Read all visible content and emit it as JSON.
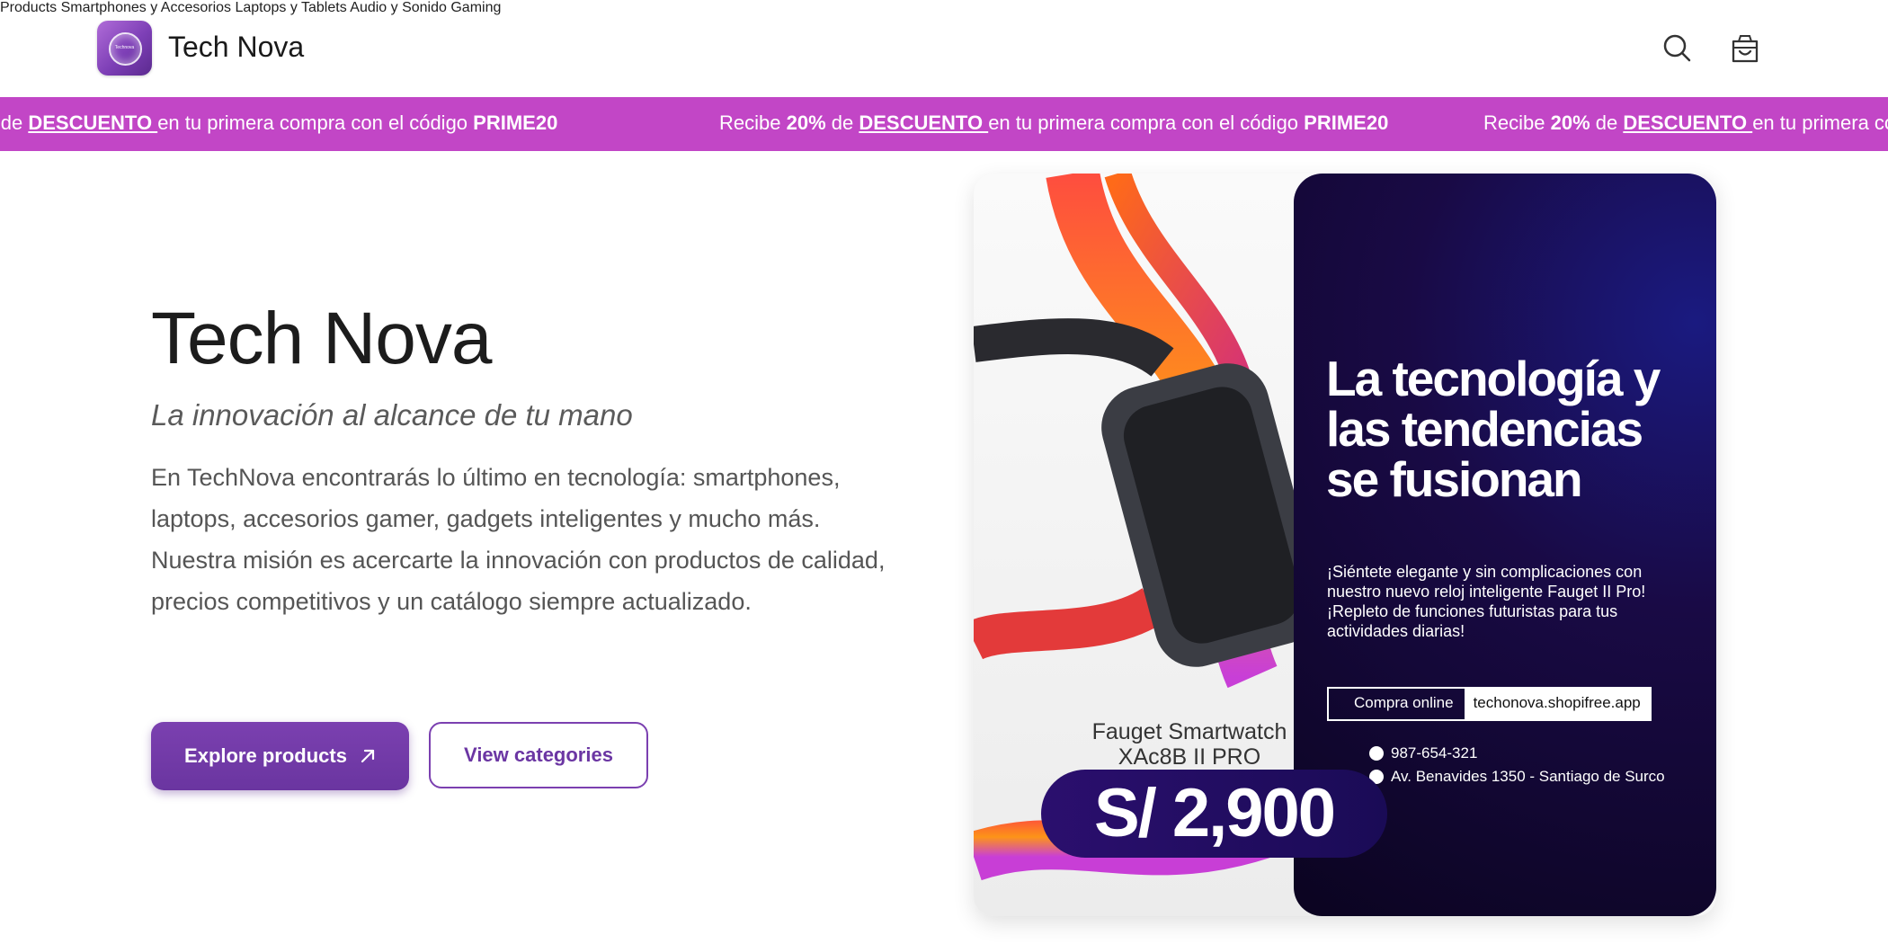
{
  "brand": {
    "name": "Tech Nova",
    "logo_text": "Technova"
  },
  "nav": {
    "items": [
      "Products",
      "Smartphones y Accesorios",
      "Laptops y Tablets",
      "Audio y Sonido",
      "Gaming"
    ]
  },
  "icons": {
    "search": "search-icon",
    "cart": "shopping-bag-icon",
    "arrow": "arrow-up-right-icon"
  },
  "promo": {
    "prefix": "Recibe ",
    "percent": "20%",
    "de": " de ",
    "discount": "DESCUENTO ",
    "middle": "en tu primera compra con el código ",
    "code": "PRIME20"
  },
  "hero": {
    "title": "Tech Nova",
    "subtitle": "La innovación al alcance de tu mano",
    "description": "En TechNova encontrarás lo último en tecnología: smartphones, laptops, accesorios gamer, gadgets inteligentes y mucho más. Nuestra misión es acercarte la innovación con productos de calidad, precios competitivos y un catálogo siempre actualizado.",
    "primary_button": "Explore products",
    "secondary_button": "View categories"
  },
  "ad": {
    "headline": "La tecnología y las tendencias se fusionan",
    "body": "¡Siéntete elegante y sin complicaciones con nuestro nuevo reloj inteligente Fauget II Pro! ¡Repleto de funciones futuristas para tus actividades diarias!",
    "cta_label": "Compra online",
    "cta_url": "techonova.shopifree.app",
    "phone": "987-654-321",
    "address": "Av. Benavides 1350 - Santiago de Surco",
    "product_name": "Fauget Smartwatch XAc8B II PRO",
    "price": "S/ 2,900"
  },
  "colors": {
    "accent": "#7b40b0",
    "promo_bg": "#c246c6",
    "ad_dark": "#190a45"
  }
}
